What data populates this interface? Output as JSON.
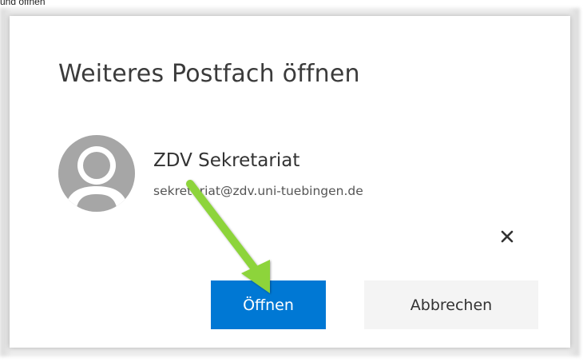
{
  "caption": "und öffnen",
  "dialog": {
    "title": "Weiteres Postfach öffnen",
    "mailbox": {
      "name": "ZDV Sekretariat",
      "email": "sekretariat@zdv.uni-tuebingen.de",
      "avatar_icon": "person-avatar-icon"
    },
    "remove_icon": "close-icon",
    "buttons": {
      "open_label": "Öffnen",
      "cancel_label": "Abbrechen"
    }
  },
  "annotation": {
    "icon": "arrow-annotation",
    "color": "#8dd43a"
  },
  "colors": {
    "primary": "#0078d4",
    "secondary": "#f4f4f4"
  }
}
